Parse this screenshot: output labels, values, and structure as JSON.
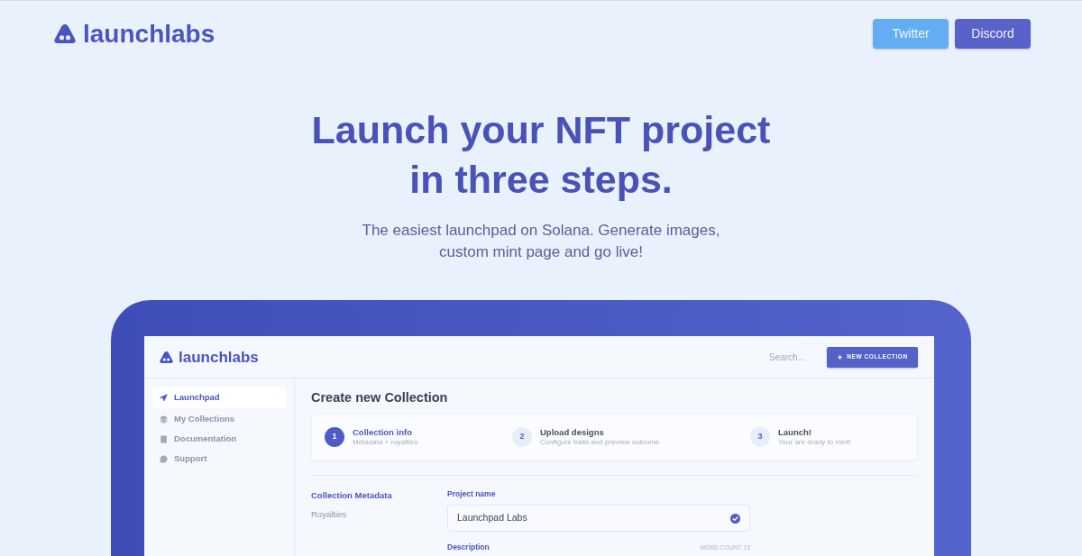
{
  "header": {
    "logo": "launchlabs",
    "buttons": [
      {
        "label": "Twitter",
        "kind": "twitter"
      },
      {
        "label": "Discord",
        "kind": "discord"
      }
    ]
  },
  "hero": {
    "title": [
      "Launch your NFT project",
      "in three steps."
    ],
    "subtitle": [
      "The easiest launchpad on Solana. Generate images,",
      "custom mint page and go live!"
    ]
  },
  "app": {
    "logo": "launchlabs",
    "search": {
      "placeholder": "Search..."
    },
    "new_button": "NEW COLLECTION",
    "sidebar": {
      "items": [
        {
          "label": "Launchpad",
          "selected": true
        },
        {
          "label": "My Collections",
          "selected": false
        },
        {
          "label": "Documentation",
          "selected": false
        },
        {
          "label": "Support",
          "selected": false
        }
      ]
    },
    "title": "Create new Collection",
    "steps": [
      {
        "number": "1",
        "title": "Collection info",
        "subtitle": "Metadata + royalties",
        "selected": true
      },
      {
        "number": "2",
        "title": "Upload designs",
        "subtitle": "Configure traits and preview outcome",
        "selected": false
      },
      {
        "number": "3",
        "title": "Launch!",
        "subtitle": "Your are ready to mint!",
        "selected": false
      }
    ],
    "sections": [
      {
        "label": "Collection Metadata",
        "selected": true
      },
      {
        "label": "Royalties",
        "selected": false
      }
    ],
    "project_name": {
      "label": "Project name",
      "value": "Launchpad Labs",
      "valid": true
    },
    "description": {
      "label": "Description",
      "word_count": "WORD COUNT: 15"
    }
  }
}
